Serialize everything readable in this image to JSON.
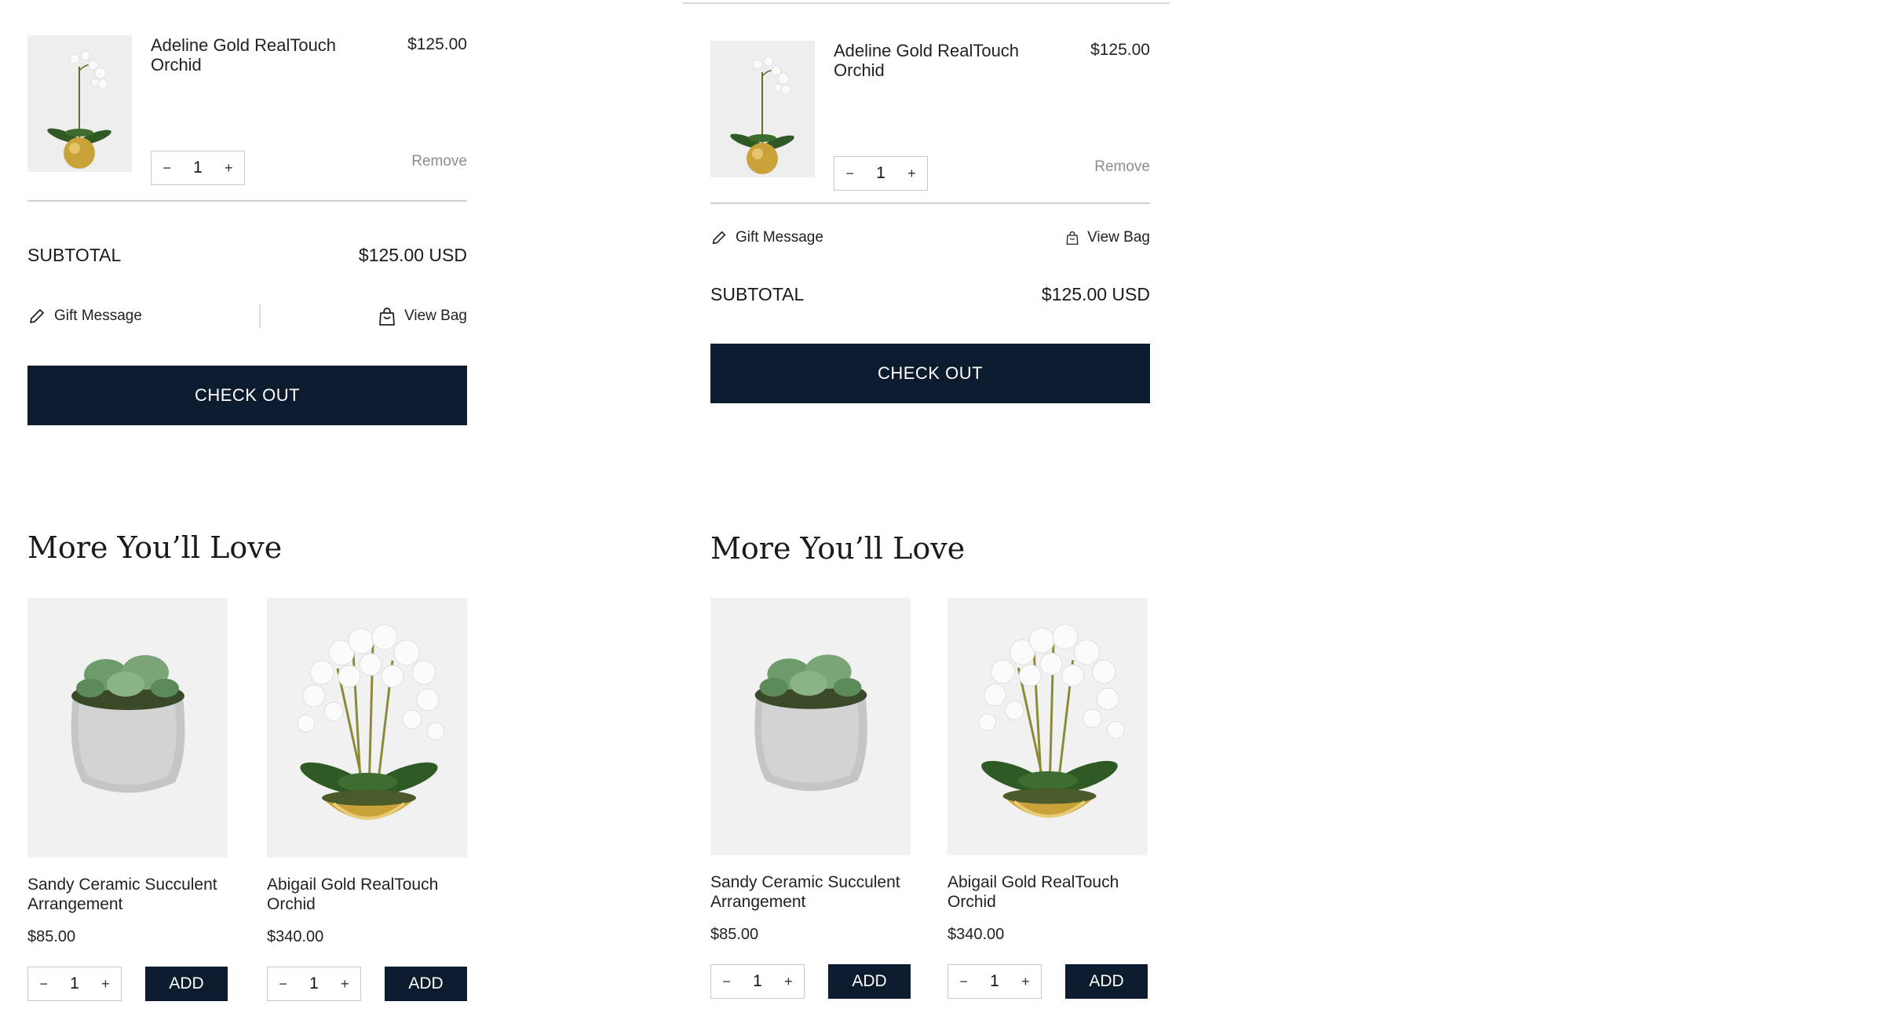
{
  "panel_a": {
    "cart_item": {
      "title": "Adeline Gold RealTouch Orchid",
      "price": "$125.00",
      "quantity": "1",
      "minus": "−",
      "plus": "+",
      "remove_label": "Remove"
    },
    "subtotal_label": "SUBTOTAL",
    "subtotal_value": "$125.00 USD",
    "gift_message_label": "Gift  Message",
    "view_bag_label": "View Bag",
    "checkout_label": "CHECK OUT",
    "recommendations_heading": "More You’ll Love",
    "products": [
      {
        "name": "Sandy Ceramic Succulent Arrangement",
        "price": "$85.00",
        "quantity": "1",
        "minus": "−",
        "plus": "+",
        "add_label": "ADD",
        "image_icon": "succulent-image"
      },
      {
        "name": "Abigail Gold RealTouch Orchid",
        "price": "$340.00",
        "quantity": "1",
        "minus": "−",
        "plus": "+",
        "add_label": "ADD",
        "image_icon": "orchid-image"
      }
    ]
  },
  "panel_b": {
    "cart_item": {
      "title": "Adeline Gold RealTouch Orchid",
      "price": "$125.00",
      "quantity": "1",
      "minus": "−",
      "plus": "+",
      "remove_label": "Remove"
    },
    "gift_message_label": "Gift  Message",
    "view_bag_label": "View Bag",
    "subtotal_label": "SUBTOTAL",
    "subtotal_value": "$125.00 USD",
    "checkout_label": "CHECK OUT",
    "recommendations_heading": "More You’ll Love",
    "products": [
      {
        "name": "Sandy Ceramic Succulent Arrangement",
        "price": "$85.00",
        "quantity": "1",
        "minus": "−",
        "plus": "+",
        "add_label": "ADD",
        "image_icon": "succulent-image"
      },
      {
        "name": "Abigail Gold RealTouch Orchid",
        "price": "$340.00",
        "quantity": "1",
        "minus": "−",
        "plus": "+",
        "add_label": "ADD",
        "image_icon": "orchid-image"
      }
    ]
  },
  "colors": {
    "primary_button": "#0d1b2e",
    "divider": "#cfcfcf",
    "muted_text": "#8c8c8c",
    "gold_vase": "#c9a23a"
  }
}
